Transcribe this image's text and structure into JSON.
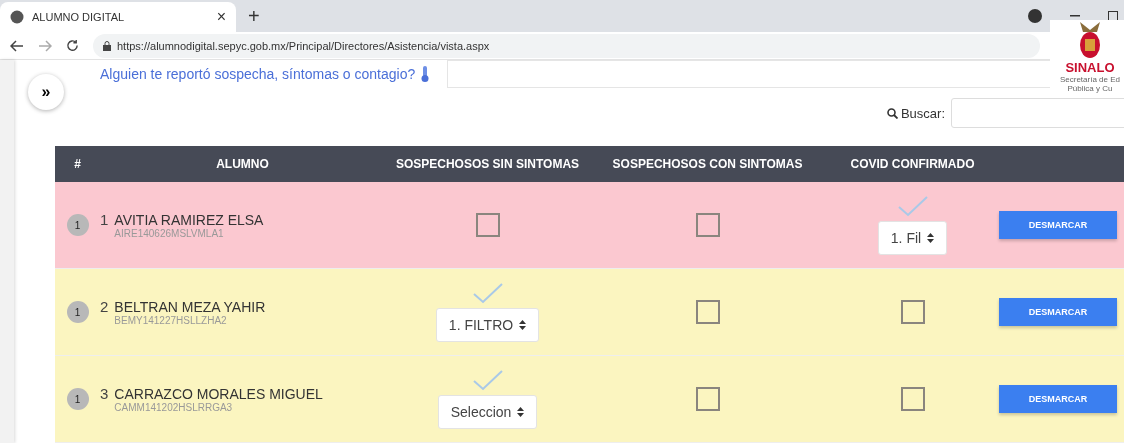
{
  "browser": {
    "tab_title": "ALUMNO DIGITAL",
    "tab_close": "×",
    "new_tab": "+",
    "url": "https://alumnodigital.sepyc.gob.mx/Principal/Directores/Asistencia/vista.aspx"
  },
  "page": {
    "question": "Alguien te reportó sospecha, síntomas o contagio?",
    "sidebar_toggle": "»",
    "logo": {
      "name": "SINALO",
      "subtitle_1": "Secretaría de Ed",
      "subtitle_2": "Pública y Cu"
    },
    "search": {
      "label": "Buscar:"
    }
  },
  "table": {
    "columns": [
      "#",
      "ALUMNO",
      "SOSPECHOSOS SIN SINTOMAS",
      "SOSPECHOSOS CON SINTOMAS",
      "COVID CONFIRMADO"
    ],
    "rows": [
      {
        "color": "#fbc8d0",
        "cells": [
          {
            "kind": "badge",
            "text": "1"
          },
          {
            "kind": "student",
            "number": "1",
            "name": "AVITIA RAMIREZ ELSA",
            "curp": "AIRE140626MSLVMLA1"
          },
          {
            "kind": "status",
            "checked": false
          },
          {
            "kind": "status",
            "checked": false
          },
          {
            "kind": "status",
            "checked": true,
            "select": "1. Fil"
          },
          {
            "kind": "button",
            "text": "DESMARCAR"
          }
        ]
      },
      {
        "color": "#fbf5c0",
        "cells": [
          {
            "kind": "badge",
            "text": "1"
          },
          {
            "kind": "student",
            "number": "2",
            "name": "BELTRAN MEZA YAHIR",
            "curp": "BEMY141227HSLLZHA2"
          },
          {
            "kind": "status",
            "checked": true,
            "select": "1. FILTRO"
          },
          {
            "kind": "status",
            "checked": false
          },
          {
            "kind": "status",
            "checked": false
          },
          {
            "kind": "button",
            "text": "DESMARCAR"
          }
        ]
      },
      {
        "color": "#fbf5c0",
        "cells": [
          {
            "kind": "badge",
            "text": "1"
          },
          {
            "kind": "student",
            "number": "3",
            "name": "CARRAZCO MORALES MIGUEL",
            "curp": "CAMM141202HSLRRGA3"
          },
          {
            "kind": "status",
            "checked": true,
            "select": "Seleccion"
          },
          {
            "kind": "status",
            "checked": false
          },
          {
            "kind": "status",
            "checked": false
          },
          {
            "kind": "button",
            "text": "DESMARCAR"
          }
        ]
      }
    ]
  }
}
